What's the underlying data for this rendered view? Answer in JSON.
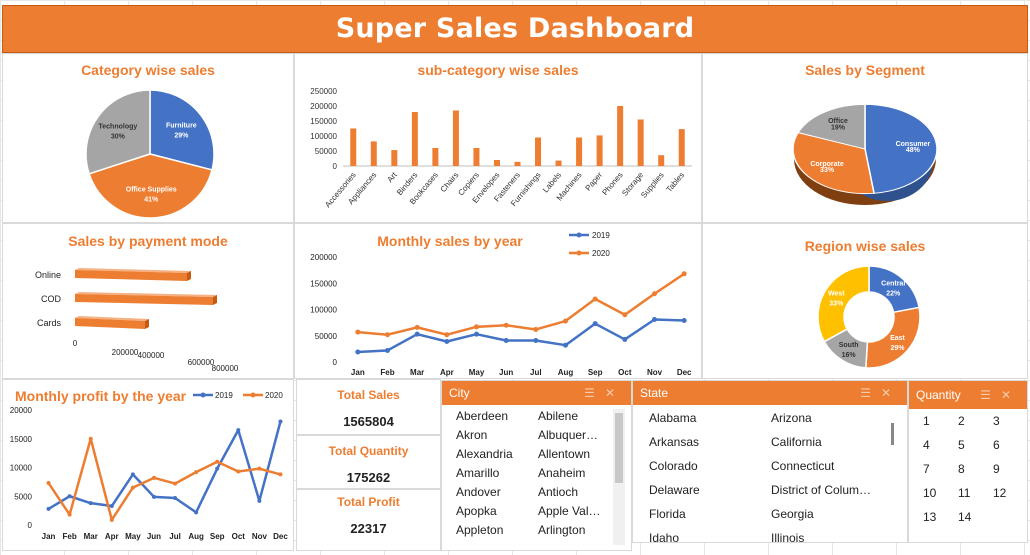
{
  "title": "Super Sales Dashboard",
  "colors": {
    "orange": "#ed7d31",
    "blue": "#4472c4",
    "gray": "#a5a5a5",
    "yellow": "#ffc000"
  },
  "panels": {
    "category": "Category wise sales",
    "subcategory": "sub-category wise sales",
    "segment": "Sales by Segment",
    "payment": "Sales by payment mode",
    "monthly_sales": "Monthly sales by year",
    "region": "Region wise sales",
    "monthly_profit": "Monthly profit by the year"
  },
  "kpis": [
    {
      "label": "Total Sales",
      "value": "1565804"
    },
    {
      "label": "Total Quantity",
      "value": "175262"
    },
    {
      "label": "Total Profit",
      "value": "22317"
    }
  ],
  "slicers": {
    "city": {
      "header": "City",
      "col1": [
        "Aberdeen",
        "Akron",
        "Alexandria",
        "Amarillo",
        "Andover",
        "Apopka",
        "Appleton"
      ],
      "col2": [
        "Abilene",
        "Albuquer…",
        "Allentown",
        "Anaheim",
        "Antioch",
        "Apple Val…",
        "Arlington"
      ]
    },
    "state": {
      "header": "State",
      "col1": [
        "Alabama",
        "Arkansas",
        "Colorado",
        "Delaware",
        "Florida",
        "Idaho"
      ],
      "col2": [
        "Arizona",
        "California",
        "Connecticut",
        "District of Colum…",
        "Georgia",
        "Illinois"
      ]
    },
    "quantity": {
      "header": "Quantity",
      "values": [
        "1",
        "2",
        "3",
        "4",
        "5",
        "6",
        "7",
        "8",
        "9",
        "10",
        "11",
        "12",
        "13",
        "14"
      ]
    }
  },
  "chart_data": [
    {
      "type": "pie",
      "title": "Category wise sales",
      "labels": [
        "Furniture",
        "Office Supplies",
        "Technology"
      ],
      "values": [
        29,
        41,
        30
      ],
      "label_texts": [
        "29%",
        "41%",
        "30%"
      ],
      "colors": [
        "#4472c4",
        "#ed7d31",
        "#a5a5a5"
      ]
    },
    {
      "type": "bar",
      "title": "sub-category wise sales",
      "categories": [
        "Accessories",
        "Appliances",
        "Art",
        "Binders",
        "Bookcases",
        "Chairs",
        "Copiers",
        "Envelopes",
        "Fasteners",
        "Furnishings",
        "Labels",
        "Machines",
        "Paper",
        "Phones",
        "Storage",
        "Supplies",
        "Tables"
      ],
      "values": [
        125000,
        82000,
        53000,
        180000,
        60000,
        185000,
        60000,
        20000,
        14000,
        95000,
        18000,
        95000,
        102000,
        200000,
        155000,
        36000,
        123000
      ],
      "ylim": [
        0,
        250000
      ],
      "yticks": [
        "0",
        "50000",
        "100000",
        "150000",
        "200000",
        "250000"
      ]
    },
    {
      "type": "pie",
      "title": "Sales by Segment",
      "labels": [
        "Consumer",
        "Corporate",
        "Office"
      ],
      "values": [
        48,
        33,
        19
      ],
      "label_texts": [
        "48%",
        "33%",
        "19%"
      ],
      "colors": [
        "#4472c4",
        "#ed7d31",
        "#a5a5a5"
      ]
    },
    {
      "type": "bar",
      "orientation": "horizontal",
      "title": "Sales by payment mode",
      "categories": [
        "Online",
        "COD",
        "Cards"
      ],
      "values": [
        560000,
        690000,
        350000
      ],
      "xlim": [
        0,
        800000
      ],
      "xticks": [
        "0",
        "200000",
        "400000",
        "600000",
        "800000"
      ]
    },
    {
      "type": "line",
      "title": "Monthly sales by year",
      "categories": [
        "Jan",
        "Feb",
        "Mar",
        "Apr",
        "May",
        "Jun",
        "Jul",
        "Aug",
        "Sep",
        "Oct",
        "Nov",
        "Dec"
      ],
      "series": [
        {
          "name": "2019",
          "values": [
            19000,
            22000,
            53000,
            39000,
            53000,
            41000,
            41000,
            32000,
            73000,
            43000,
            81000,
            79000
          ]
        },
        {
          "name": "2020",
          "values": [
            57000,
            52000,
            66000,
            52000,
            67000,
            70000,
            62000,
            78000,
            120000,
            90000,
            130000,
            168000
          ]
        }
      ],
      "ylim": [
        0,
        200000
      ],
      "yticks": [
        "0",
        "50000",
        "100000",
        "150000",
        "200000"
      ],
      "legend": "top-right"
    },
    {
      "type": "pie",
      "title": "Region wise sales",
      "labels": [
        "Central",
        "East",
        "South",
        "West"
      ],
      "values": [
        22,
        29,
        16,
        33
      ],
      "label_texts": [
        "22%",
        "29%",
        "16%",
        "33%"
      ],
      "colors": [
        "#4472c4",
        "#ed7d31",
        "#a5a5a5",
        "#ffc000"
      ]
    },
    {
      "type": "line",
      "title": "Monthly profit by the year",
      "categories": [
        "Jan",
        "Feb",
        "Mar",
        "Apr",
        "May",
        "Jun",
        "Jul",
        "Aug",
        "Sep",
        "Oct",
        "Nov",
        "Dec"
      ],
      "series": [
        {
          "name": "2019",
          "values": [
            2800,
            5000,
            3800,
            3300,
            8800,
            4900,
            4700,
            2200,
            9800,
            16500,
            4200,
            18000
          ]
        },
        {
          "name": "2020",
          "values": [
            7300,
            1800,
            15000,
            900,
            6500,
            8200,
            7200,
            9200,
            11000,
            9300,
            9800,
            8800
          ]
        }
      ],
      "ylim": [
        0,
        20000
      ],
      "yticks": [
        "0",
        "5000",
        "10000",
        "15000",
        "20000"
      ],
      "legend": "top-right"
    }
  ]
}
